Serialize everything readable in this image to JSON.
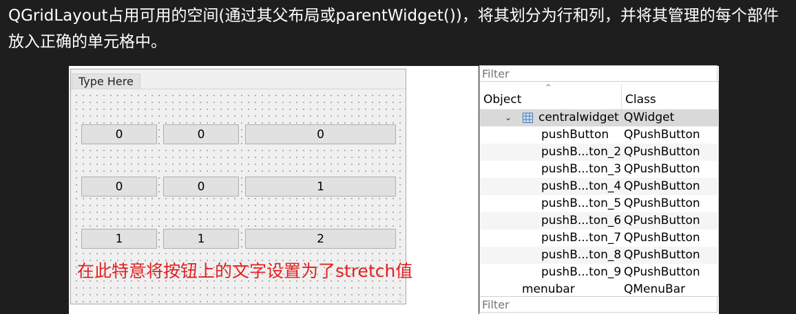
{
  "heading": {
    "text": "QGridLayout占用可用的空间(通过其父布局或parentWidget())，将其划分为行和列，并将其管理的每个部件放入正确的单元格中。"
  },
  "designer": {
    "menu_placeholder": "Type Here",
    "grid_buttons": [
      {
        "label": "0"
      },
      {
        "label": "0"
      },
      {
        "label": "0"
      },
      {
        "label": "0"
      },
      {
        "label": "0"
      },
      {
        "label": "1"
      },
      {
        "label": "1"
      },
      {
        "label": "1"
      },
      {
        "label": "2"
      }
    ],
    "annotation": "在此特意将按钮上的文字设置为了stretch值",
    "annotation_color": "#e32020"
  },
  "inspector": {
    "filter_placeholder": "Filter",
    "columns": {
      "object": "Object",
      "class": "Class"
    },
    "rows": [
      {
        "object": "centralwidget",
        "class": "QWidget",
        "level": 0,
        "expanded": true,
        "icon": "grid-layout-icon",
        "selected": true
      },
      {
        "object": "pushButton",
        "class": "QPushButton",
        "level": 1
      },
      {
        "object": "pushB...ton_2",
        "class": "QPushButton",
        "level": 1
      },
      {
        "object": "pushB...ton_3",
        "class": "QPushButton",
        "level": 1
      },
      {
        "object": "pushB...ton_4",
        "class": "QPushButton",
        "level": 1
      },
      {
        "object": "pushB...ton_5",
        "class": "QPushButton",
        "level": 1
      },
      {
        "object": "pushB...ton_6",
        "class": "QPushButton",
        "level": 1
      },
      {
        "object": "pushB...ton_7",
        "class": "QPushButton",
        "level": 1
      },
      {
        "object": "pushB...ton_8",
        "class": "QPushButton",
        "level": 1
      },
      {
        "object": "pushB...ton_9",
        "class": "QPushButton",
        "level": 1
      },
      {
        "object": "menubar",
        "class": "QMenuBar",
        "level": 0
      }
    ],
    "bottom_filter_placeholder": "Filter"
  },
  "colors": {
    "page_background": "#1e1e1e",
    "heading_text": "#ffffff",
    "selection": "#d9d9d9"
  }
}
